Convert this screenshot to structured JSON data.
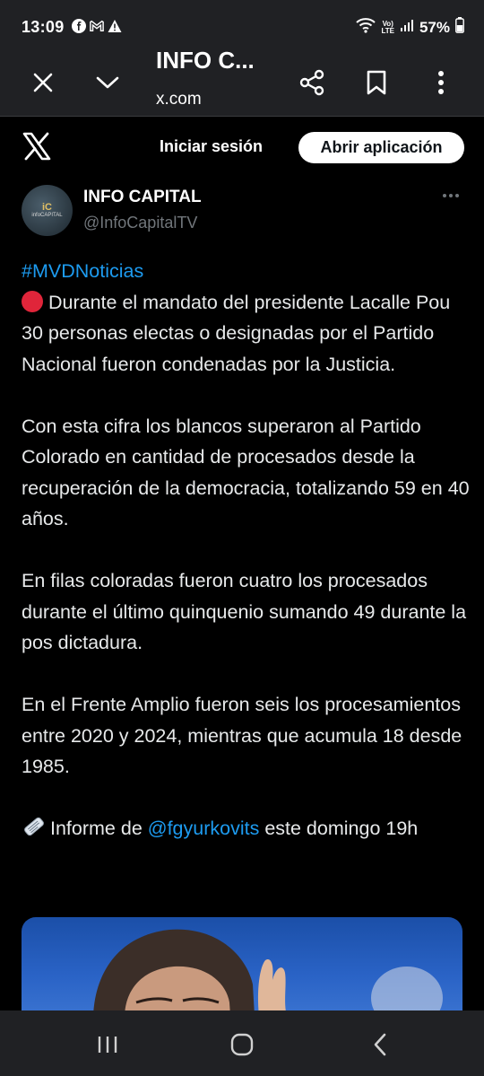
{
  "status_bar": {
    "time": "13:09",
    "battery": "57%",
    "volte": "Vo) LTE"
  },
  "browser": {
    "title": "INFO C...",
    "url": "x.com"
  },
  "x_header": {
    "login_label": "Iniciar sesión",
    "open_app_label": "Abrir aplicación"
  },
  "author": {
    "name": "INFO CAPITAL",
    "handle": "@InfoCapitalTV",
    "avatar_text_top": "iC",
    "avatar_text_bottom": "infoCAPITAL"
  },
  "tweet": {
    "hashtag": "#MVDNoticias",
    "paragraph1": "Durante el mandato del presidente Lacalle Pou 30 personas electas o designadas por el Partido Nacional fueron condenadas por la Justicia.",
    "paragraph2": "Con esta cifra los blancos superaron al Partido Colorado en cantidad de procesados desde la recuperación de la democracia, totalizando 59 en 40 años.",
    "paragraph3": "En filas coloradas fueron cuatro los procesados durante el último quinquenio sumando 49 durante la pos dictadura.",
    "paragraph4": "En el Frente Amplio fueron seis los procesamientos entre 2020 y 2024, mientras que acumula 18 desde 1985.",
    "informe_prefix": "Informe de ",
    "mention": "@fgyurkovits",
    "informe_suffix": " este domingo 19h"
  },
  "colors": {
    "background": "#000000",
    "chrome": "#202124",
    "link": "#1d9bf0",
    "text": "#e7e9ea",
    "muted": "#71767b"
  }
}
